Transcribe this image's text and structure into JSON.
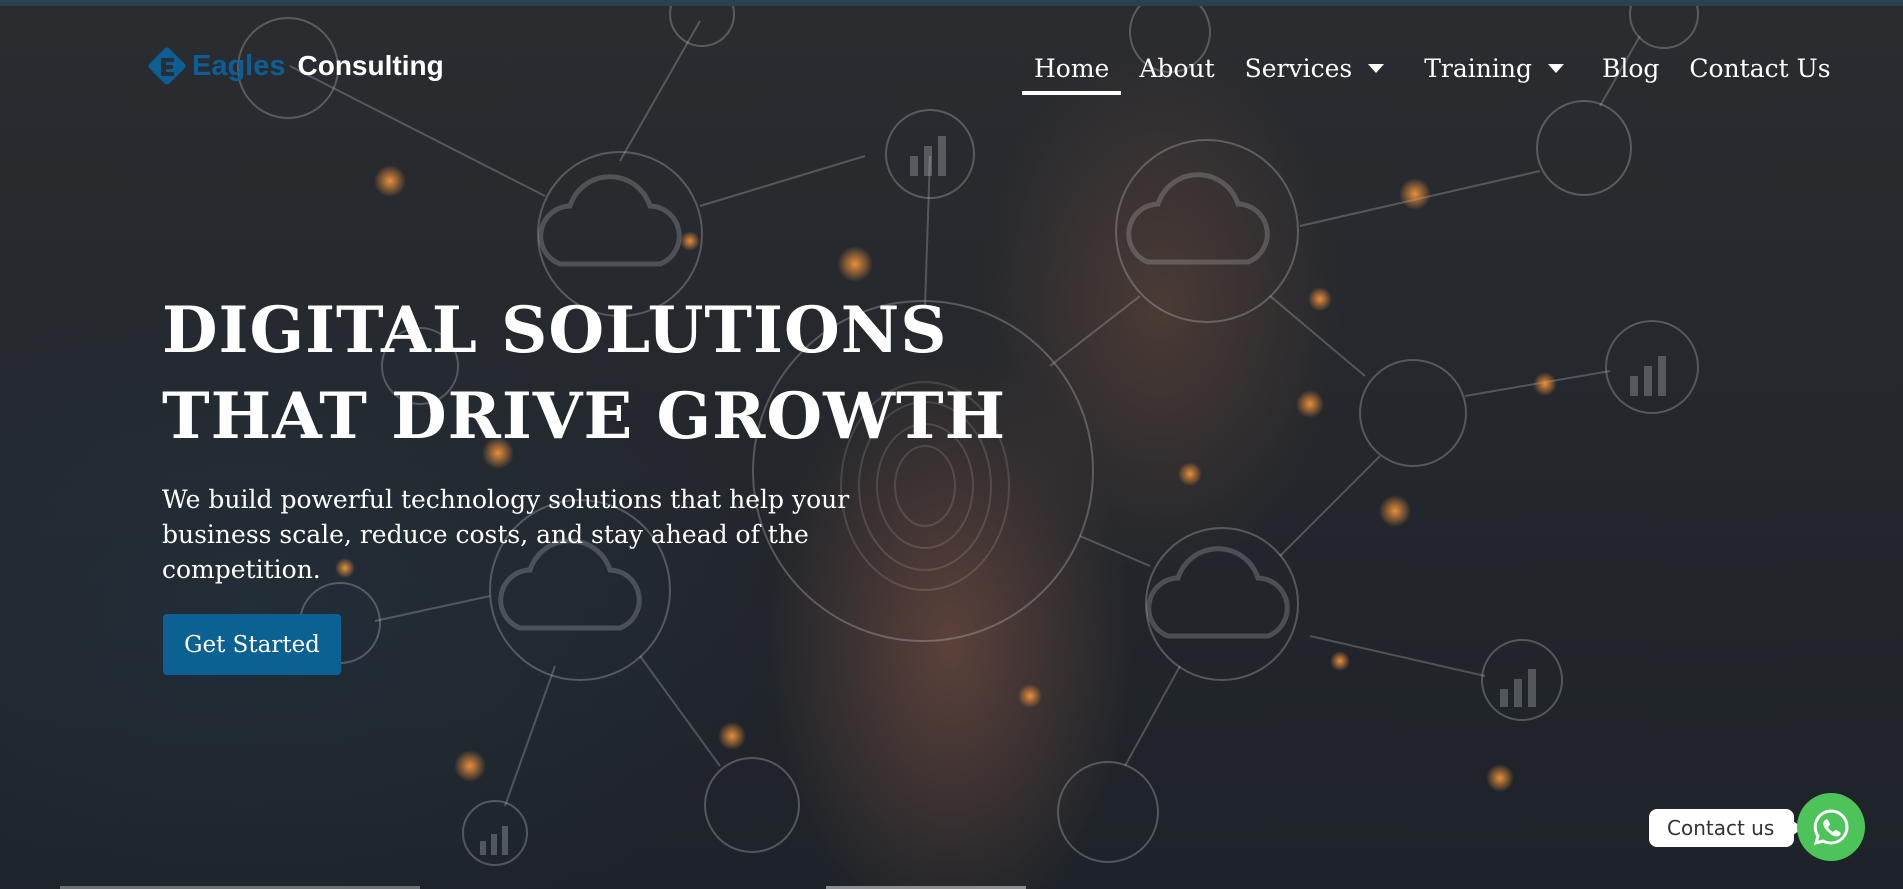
{
  "brand": {
    "name_part1": "Eagles",
    "name_part2": "Consulting",
    "colors": {
      "primary": "#0c6193",
      "logo_blue": "#0c5e95",
      "whatsapp_green": "#4dc45a"
    }
  },
  "nav": {
    "items": [
      {
        "label": "Home",
        "active": true
      },
      {
        "label": "About"
      },
      {
        "label": "Services",
        "has_dropdown": true
      },
      {
        "label": "Training",
        "has_dropdown": true
      },
      {
        "label": "Blog"
      },
      {
        "label": "Contact Us"
      }
    ]
  },
  "hero": {
    "headline_line1": "DIGITAL SOLUTIONS",
    "headline_line2": "THAT DRIVE GROWTH",
    "subtext_line1": "We build powerful technology solutions that help your",
    "subtext_line2": "business scale, reduce costs, and stay ahead of the",
    "subtext_line3": "competition.",
    "cta_label": "Get Started"
  },
  "widget": {
    "contact_label": "Contact us",
    "icon": "whatsapp-icon"
  }
}
